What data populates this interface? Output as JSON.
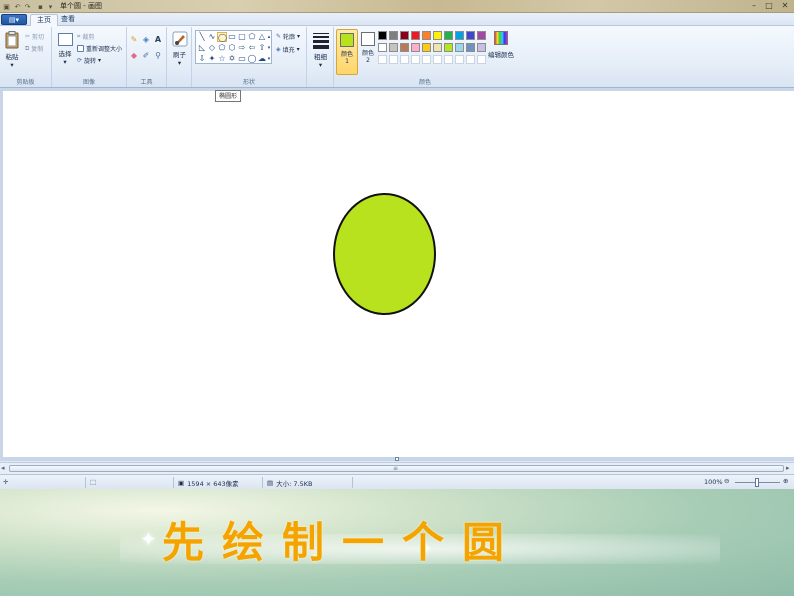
{
  "window": {
    "title": "单个圆 - 画图",
    "minimize": "–",
    "maximize": "□",
    "close": "✕"
  },
  "tabs": {
    "app_menu": "▤▾",
    "home": "主页",
    "view": "查看"
  },
  "ribbon": {
    "clipboard": {
      "paste": "粘贴",
      "cut": "剪切",
      "copy": "复制",
      "label": "剪贴板"
    },
    "image": {
      "select": "选择",
      "crop": "裁剪",
      "resize": "重新调整大小",
      "rotate": "旋转",
      "label": "图像"
    },
    "tools": {
      "label": "工具",
      "text_glyph": "A"
    },
    "brushes": {
      "label": "刷子"
    },
    "shapes": {
      "outline": "轮廓",
      "fill": "填充",
      "label": "形状",
      "tooltip": "椭圆形"
    },
    "size": {
      "label": "粗细"
    },
    "colors": {
      "color1": "颜色 1",
      "color2": "颜色 2",
      "edit": "编辑颜色",
      "label": "颜色",
      "color1_value": "#b8e21e",
      "color2_value": "#ffffff",
      "row1": [
        "#000000",
        "#7f7f7f",
        "#880015",
        "#ed1c24",
        "#ff7f27",
        "#fff200",
        "#22b14c",
        "#00a2e8",
        "#3f48cc",
        "#a349a4"
      ],
      "row2": [
        "#ffffff",
        "#c3c3c3",
        "#b97a57",
        "#ffaec9",
        "#ffc90e",
        "#efe4b0",
        "#b5e61d",
        "#99d9ea",
        "#7092be",
        "#c8bfe7"
      ]
    }
  },
  "canvas": {
    "shape": "ellipse",
    "fill_color": "#b8e21e",
    "stroke_color": "#111111"
  },
  "status": {
    "dimensions": "1594 × 643像素",
    "size": "大小: 7.5KB",
    "zoom": "100%"
  },
  "slide": {
    "caption": "先绘制一个圆",
    "caption_color": "#f5a300"
  }
}
